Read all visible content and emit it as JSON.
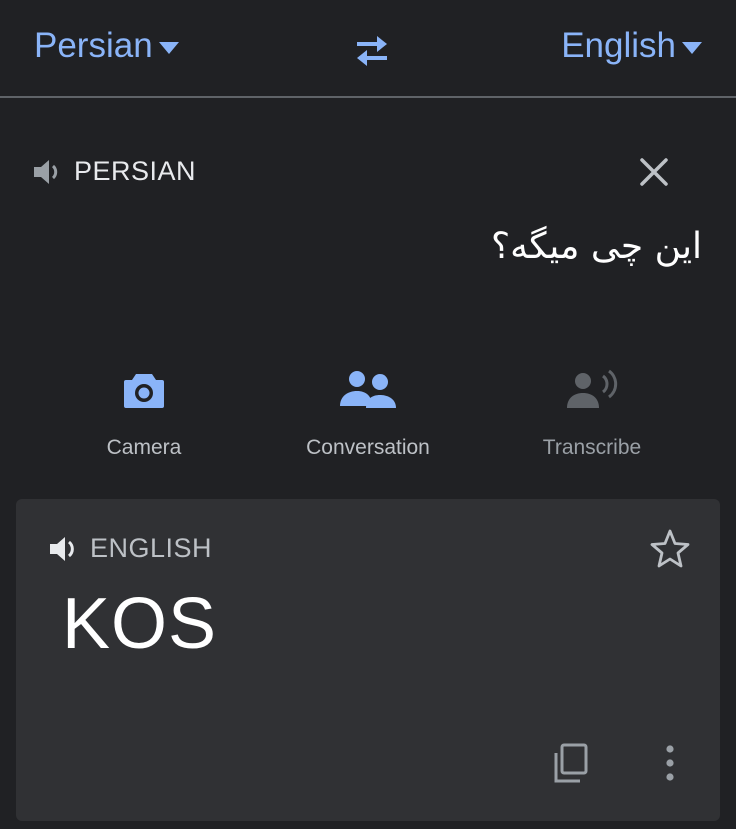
{
  "header": {
    "source_lang": "Persian",
    "target_lang": "English",
    "swap_icon": "swap-arrows-icon",
    "accent_color": "#8ab4f8"
  },
  "input": {
    "language_label": "PERSIAN",
    "speaker_icon": "speaker-icon",
    "clear_icon": "close-icon",
    "text": "این چی میگه؟"
  },
  "tools": [
    {
      "label": "Camera",
      "icon": "camera-icon",
      "enabled": true
    },
    {
      "label": "Conversation",
      "icon": "people-icon",
      "enabled": true
    },
    {
      "label": "Transcribe",
      "icon": "transcribe-icon",
      "enabled": false
    }
  ],
  "result": {
    "language_label": "ENGLISH",
    "speaker_icon": "speaker-icon",
    "text": "KOS",
    "star_icon": "star-outline-icon",
    "copy_icon": "copy-icon",
    "more_icon": "more-vert-icon"
  }
}
